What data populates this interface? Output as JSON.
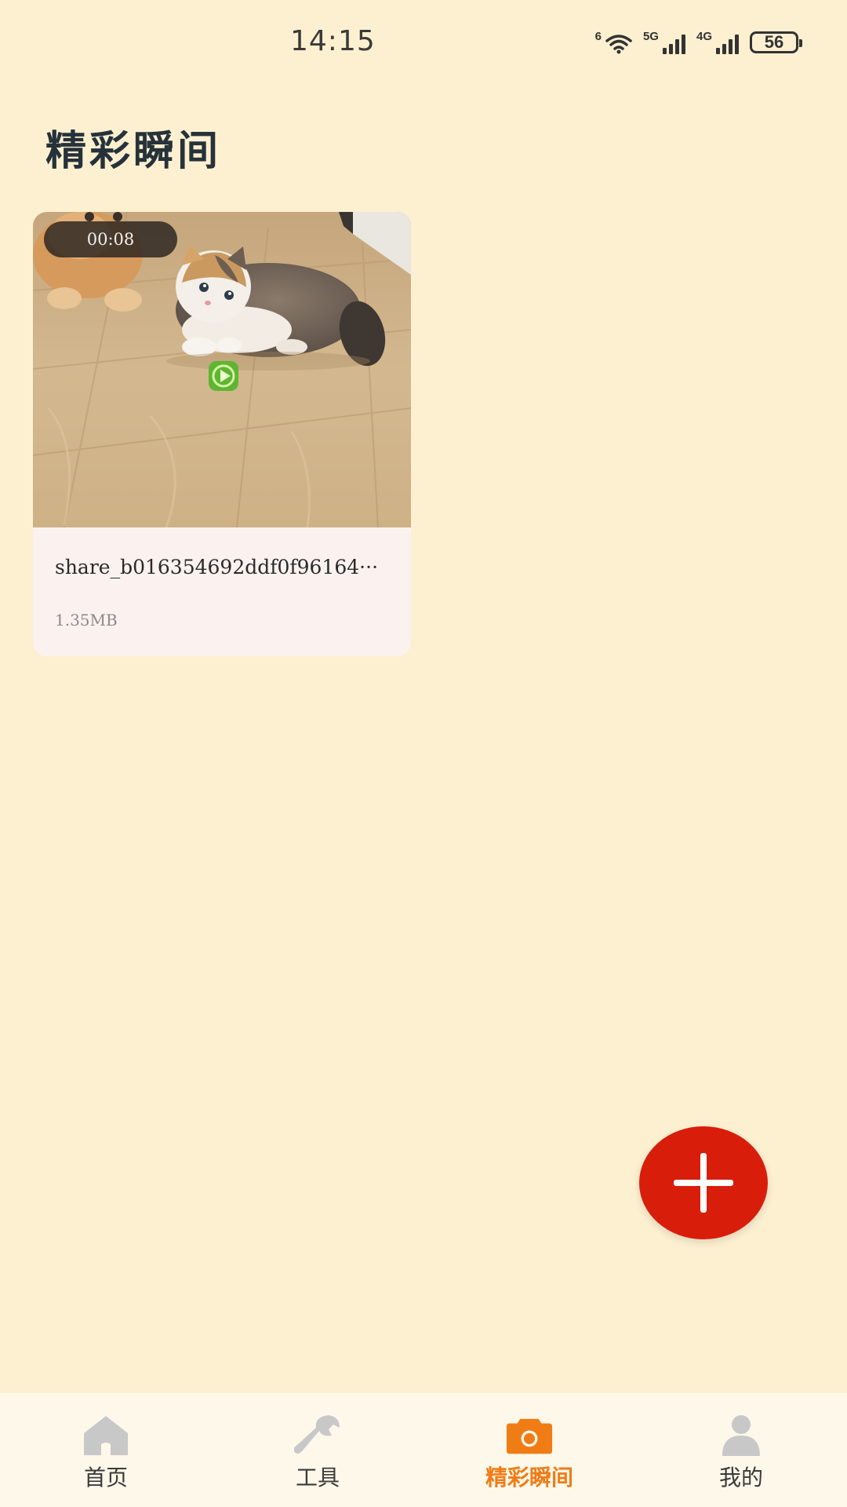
{
  "status_bar": {
    "time": "14:15",
    "wifi_tag": "6",
    "signal1_tag": "5G",
    "signal2_tag": "4G",
    "battery": "56"
  },
  "page": {
    "title": "精彩瞬间"
  },
  "videos": [
    {
      "duration": "00:08",
      "file_name": "share_b016354692ddf0f96164···",
      "file_size": "1.35MB",
      "thumbnail": "kitten-on-wooden-floor"
    }
  ],
  "fab": {
    "icon": "plus-icon",
    "color": "#d81e0b"
  },
  "bottom_nav": {
    "items": [
      {
        "label": "首页",
        "icon": "home-icon",
        "active": false
      },
      {
        "label": "工具",
        "icon": "wrench-icon",
        "active": false
      },
      {
        "label": "精彩瞬间",
        "icon": "camera-icon",
        "active": true
      },
      {
        "label": "我的",
        "icon": "user-icon",
        "active": false
      }
    ],
    "active_color": "#f07c16",
    "inactive_color": "#c8c8c8"
  },
  "colors": {
    "background": "#fdf0d0",
    "card": "#fbf2f0",
    "nav_background": "#fef8ea"
  }
}
